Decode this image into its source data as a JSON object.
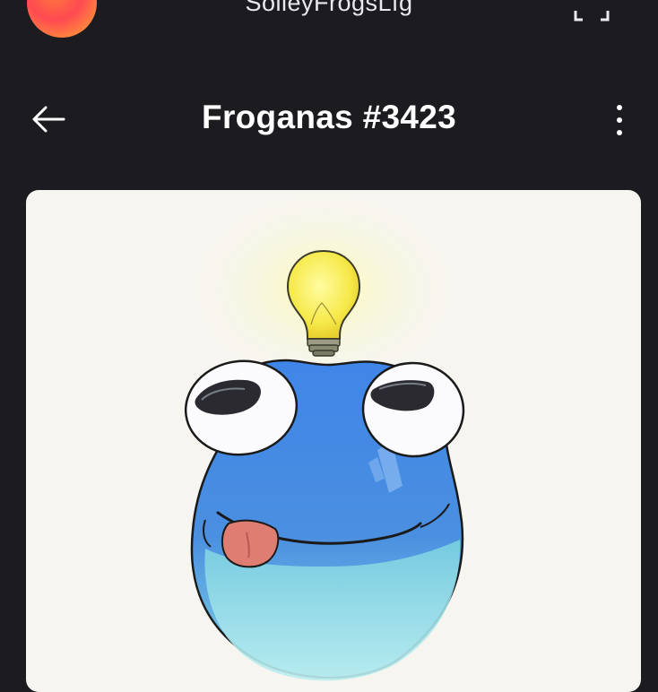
{
  "wallet": {
    "name": "SolleyFrogsLfg"
  },
  "header": {
    "title": "Froganas #3423"
  },
  "icons": {
    "avatar": "wallet-avatar-gradient",
    "expand": "expand-icon",
    "back": "arrow-left-icon",
    "more": "vertical-ellipsis-icon"
  },
  "colors": {
    "background": "#1b1b20",
    "card": "#f7f5ef",
    "frog": "#3d86e0"
  }
}
